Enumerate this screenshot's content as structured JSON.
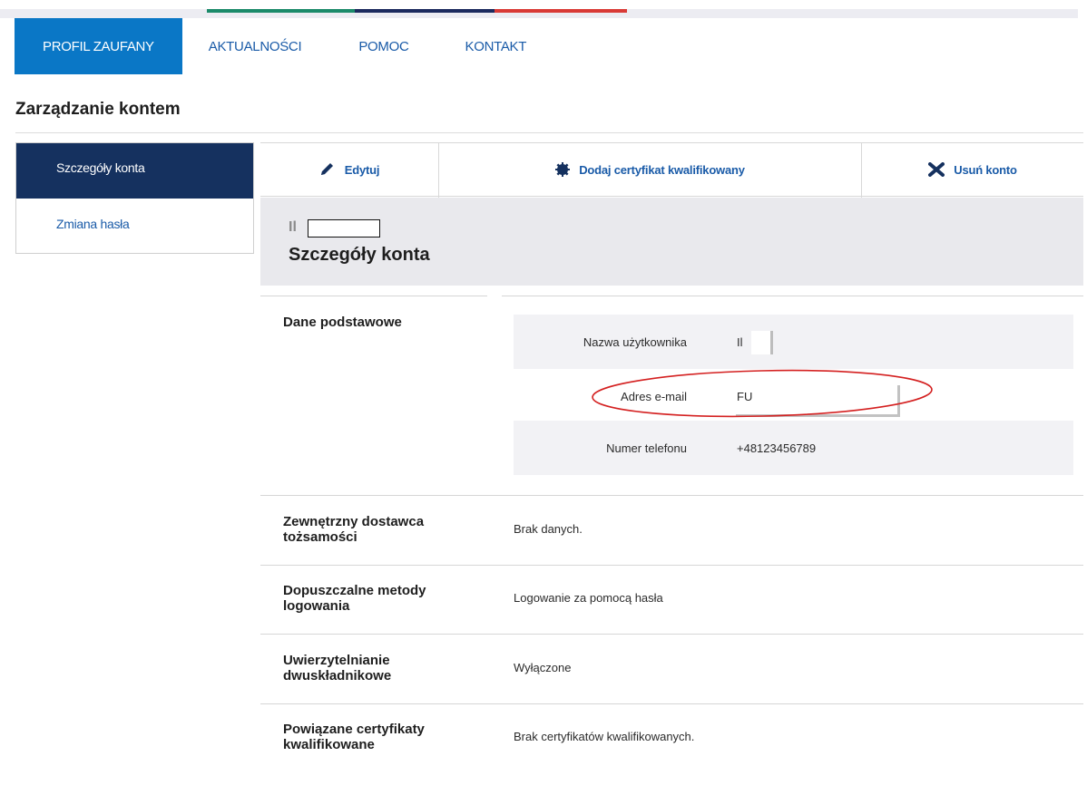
{
  "topbar_colors": [
    "#1b8a6a",
    "#1b2a5e",
    "#d93a36"
  ],
  "nav": {
    "items": [
      {
        "label": "PROFIL ZAUFANY",
        "active": true
      },
      {
        "label": "AKTUALNOŚCI",
        "active": false
      },
      {
        "label": "POMOC",
        "active": false
      },
      {
        "label": "KONTAKT",
        "active": false
      }
    ]
  },
  "page_title": "Zarządzanie kontem",
  "sidebar": {
    "items": [
      {
        "label": "Szczegóły konta",
        "active": true
      },
      {
        "label": "Zmiana hasła",
        "active": false
      }
    ]
  },
  "actions": {
    "edit": {
      "label": "Edytuj",
      "icon": "pencil-icon"
    },
    "add_cert": {
      "label": "Dodaj certyfikat kwalifikowany",
      "icon": "badge-icon"
    },
    "delete": {
      "label": "Usuń konto",
      "icon": "x-icon"
    }
  },
  "header": {
    "user_prefix": "Il",
    "title": "Szczegóły konta"
  },
  "sections": {
    "basic": {
      "label": "Dane podstawowe",
      "fields": [
        {
          "label": "Nazwa użytkownika",
          "value": "Il"
        },
        {
          "label": "Adres e-mail",
          "value": "FU"
        },
        {
          "label": "Numer telefonu",
          "value": "+48123456789"
        }
      ]
    },
    "external_idp": {
      "label": "Zewnętrzny dostawca tożsamości",
      "value": "Brak danych."
    },
    "login_methods": {
      "label": "Dopuszczalne metody logowania",
      "value": "Logowanie za pomocą hasła"
    },
    "two_factor": {
      "label": "Uwierzytelnianie dwuskładnikowe",
      "value": "Wyłączone"
    },
    "certificates": {
      "label": "Powiązane certyfikaty kwalifikowane",
      "value": "Brak certyfikatów kwalifikowanych."
    }
  },
  "annotation_color": "#d42020"
}
